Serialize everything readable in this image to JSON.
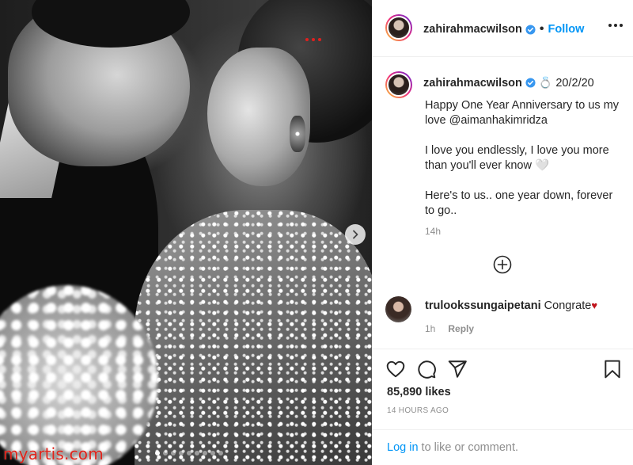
{
  "post": {
    "username": "zahirahmacwilson",
    "follow_label": "Follow",
    "separator": "•",
    "caption": {
      "ring_emoji": "💍",
      "date": "20/2/20",
      "lines": [
        "Happy One Year Anniversary to us my love @aimanhakimridza",
        "I love you endlessly, I love you more than you'll ever know 🤍",
        "Here's to us.. one year down, forever to go.."
      ],
      "time": "14h"
    },
    "comment": {
      "username": "trulookssungaipetani",
      "text": "Congrate",
      "heart": "♥",
      "time": "1h",
      "reply_label": "Reply"
    },
    "likes": "85,890 likes",
    "post_time": "14 HOURS AGO",
    "login_link": "Log in",
    "login_rest": " to like or comment.",
    "carousel": {
      "count": 9,
      "active_index": 0
    }
  },
  "watermark": "myartis.com",
  "colors": {
    "accent_blue": "#0095f6",
    "text": "#262626",
    "muted": "#8e8e8e",
    "watermark_red": "#e2231a",
    "heart_red": "#c0131b"
  },
  "icons": {
    "verified": "verified-badge-icon",
    "like": "heart-icon",
    "comment": "comment-icon",
    "share": "paper-plane-icon",
    "save": "bookmark-icon",
    "more": "more-options-icon",
    "next": "chevron-right-icon",
    "load_more": "plus-circle-icon"
  }
}
